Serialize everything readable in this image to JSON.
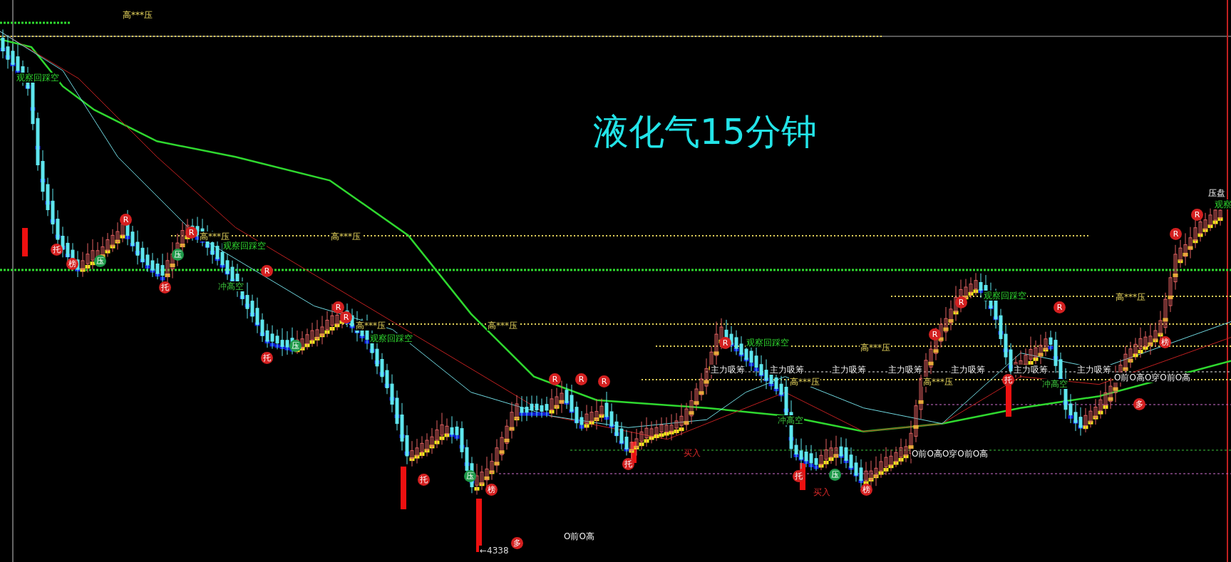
{
  "title": "液化气15分钟",
  "labels": [
    {
      "kind": "resistance",
      "text": "高***压"
    },
    {
      "kind": "observe",
      "text": "观察回踩空"
    },
    {
      "kind": "resistance",
      "text": "高***压"
    },
    {
      "kind": "resistance",
      "text": "高***压"
    },
    {
      "kind": "observe",
      "text": "观察回踩空"
    },
    {
      "kind": "rush",
      "text": "冲高空"
    },
    {
      "kind": "resistance",
      "text": "高***压"
    },
    {
      "kind": "resistance",
      "text": "高***压"
    },
    {
      "kind": "observe",
      "text": "观察回踩空"
    },
    {
      "kind": "observe",
      "text": "观察回踩空"
    },
    {
      "kind": "resistance",
      "text": "高***压"
    },
    {
      "kind": "accumulation",
      "text": "主力吸筹"
    },
    {
      "kind": "accumulation",
      "text": "主力吸筹"
    },
    {
      "kind": "accumulation",
      "text": "主力吸筹"
    },
    {
      "kind": "accumulation",
      "text": "主力吸筹"
    },
    {
      "kind": "accumulation",
      "text": "主力吸筹"
    },
    {
      "kind": "accumulation",
      "text": "主力吸筹"
    },
    {
      "kind": "accumulation",
      "text": "主力吸筹"
    },
    {
      "kind": "resistance",
      "text": "高***压"
    },
    {
      "kind": "resistance",
      "text": "高***压"
    },
    {
      "kind": "rush",
      "text": "冲高空"
    },
    {
      "kind": "rush",
      "text": "冲高空"
    },
    {
      "kind": "observe",
      "text": "观察回踩空"
    },
    {
      "kind": "resistance",
      "text": "高***压"
    },
    {
      "kind": "pattern",
      "text": "O前O高O穿O前O高"
    },
    {
      "kind": "pattern",
      "text": "O前O高O穿O前O高"
    },
    {
      "kind": "pattern",
      "text": "O前O高"
    },
    {
      "kind": "price",
      "text": "←4338"
    },
    {
      "kind": "pressure",
      "text": "压盘"
    },
    {
      "kind": "observe",
      "text": "观察"
    },
    {
      "kind": "buy",
      "text": "买入"
    },
    {
      "kind": "buy",
      "text": "买入"
    }
  ],
  "markers": [
    {
      "text": "托",
      "color": "#d42020"
    },
    {
      "text": "榜",
      "color": "#d42020"
    },
    {
      "text": "压",
      "color": "#1f9a4a"
    },
    {
      "text": "R",
      "color": "#d42020"
    },
    {
      "text": "R",
      "color": "#d42020"
    },
    {
      "text": "托",
      "color": "#d42020"
    },
    {
      "text": "压",
      "color": "#1f9a4a"
    },
    {
      "text": "R",
      "color": "#d42020"
    },
    {
      "text": "托",
      "color": "#d42020"
    },
    {
      "text": "压",
      "color": "#1f9a4a"
    },
    {
      "text": "R",
      "color": "#d42020"
    },
    {
      "text": "R",
      "color": "#d42020"
    },
    {
      "text": "托",
      "color": "#d42020"
    },
    {
      "text": "压",
      "color": "#1f9a4a"
    },
    {
      "text": "榜",
      "color": "#d42020"
    },
    {
      "text": "R",
      "color": "#d42020"
    },
    {
      "text": "R",
      "color": "#d42020"
    },
    {
      "text": "R",
      "color": "#d42020"
    },
    {
      "text": "托",
      "color": "#d42020"
    },
    {
      "text": "R",
      "color": "#d42020"
    },
    {
      "text": "R",
      "color": "#d42020"
    },
    {
      "text": "R",
      "color": "#d42020"
    },
    {
      "text": "R",
      "color": "#d42020"
    },
    {
      "text": "榜",
      "color": "#d42020"
    },
    {
      "text": "托",
      "color": "#d42020"
    },
    {
      "text": "托",
      "color": "#d42020"
    },
    {
      "text": "压",
      "color": "#1f9a4a"
    },
    {
      "text": "榜",
      "color": "#d42020"
    },
    {
      "text": "多",
      "color": "#d42020"
    },
    {
      "text": "多",
      "color": "#d42020"
    },
    {
      "text": "R",
      "color": "#d42020"
    },
    {
      "text": "R",
      "color": "#d42020"
    }
  ]
}
